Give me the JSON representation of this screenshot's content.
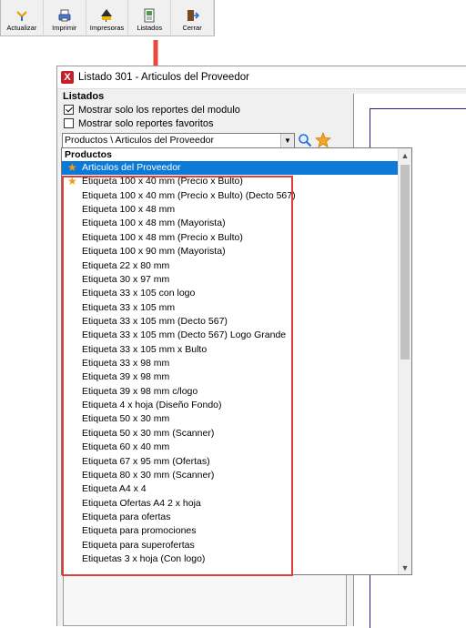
{
  "toolbar": {
    "buttons": [
      {
        "label": "Actualizar",
        "icon": "refresh-icon"
      },
      {
        "label": "Imprimir",
        "icon": "printer-icon"
      },
      {
        "label": "Impresoras",
        "icon": "printers-icon"
      },
      {
        "label": "Listados",
        "icon": "list-icon"
      },
      {
        "label": "Cerrar",
        "icon": "close-door-icon"
      }
    ]
  },
  "window": {
    "title": "Listado 301 - Articulos del Proveedor",
    "app_icon_letter": "X"
  },
  "listados": {
    "section_label": "Listados",
    "check_module": {
      "label": "Mostrar solo los reportes del modulo",
      "checked": true
    },
    "check_favorites": {
      "label": "Mostrar solo reportes favoritos",
      "checked": false
    },
    "combo_value": "Productos \\ Articulos del Proveedor"
  },
  "dropdown": {
    "group_header": "Productos",
    "items": [
      {
        "label": "Articulos del Proveedor",
        "favorite": true,
        "selected": true
      },
      {
        "label": "Etiqueta 100 x 40 mm (Precio x Bulto)",
        "favorite": true,
        "selected": false
      },
      {
        "label": "Etiqueta 100 x 40 mm (Precio x Bulto) (Decto 567)",
        "favorite": false,
        "selected": false
      },
      {
        "label": "Etiqueta 100 x 48 mm",
        "favorite": false,
        "selected": false
      },
      {
        "label": "Etiqueta 100 x 48 mm (Mayorista)",
        "favorite": false,
        "selected": false
      },
      {
        "label": "Etiqueta 100 x 48 mm (Precio x Bulto)",
        "favorite": false,
        "selected": false
      },
      {
        "label": "Etiqueta 100 x 90 mm (Mayorista)",
        "favorite": false,
        "selected": false
      },
      {
        "label": "Etiqueta 22 x 80 mm",
        "favorite": false,
        "selected": false
      },
      {
        "label": "Etiqueta 30 x 97 mm",
        "favorite": false,
        "selected": false
      },
      {
        "label": "Etiqueta 33 x 105 con logo",
        "favorite": false,
        "selected": false
      },
      {
        "label": "Etiqueta 33 x 105 mm",
        "favorite": false,
        "selected": false
      },
      {
        "label": "Etiqueta 33 x 105 mm (Decto 567)",
        "favorite": false,
        "selected": false
      },
      {
        "label": "Etiqueta 33 x 105 mm (Decto 567) Logo Grande",
        "favorite": false,
        "selected": false
      },
      {
        "label": "Etiqueta 33 x 105 mm x Bulto",
        "favorite": false,
        "selected": false
      },
      {
        "label": "Etiqueta 33 x 98 mm",
        "favorite": false,
        "selected": false
      },
      {
        "label": "Etiqueta 39 x 98 mm",
        "favorite": false,
        "selected": false
      },
      {
        "label": "Etiqueta 39 x 98 mm c/logo",
        "favorite": false,
        "selected": false
      },
      {
        "label": "Etiqueta 4 x hoja (Diseño Fondo)",
        "favorite": false,
        "selected": false
      },
      {
        "label": "Etiqueta 50 x 30 mm",
        "favorite": false,
        "selected": false
      },
      {
        "label": "Etiqueta 50 x 30 mm (Scanner)",
        "favorite": false,
        "selected": false
      },
      {
        "label": "Etiqueta 60 x 40 mm",
        "favorite": false,
        "selected": false
      },
      {
        "label": "Etiqueta 67 x 95 mm (Ofertas)",
        "favorite": false,
        "selected": false
      },
      {
        "label": "Etiqueta 80 x 30 mm (Scanner)",
        "favorite": false,
        "selected": false
      },
      {
        "label": "Etiqueta A4 x 4",
        "favorite": false,
        "selected": false
      },
      {
        "label": "Etiqueta Ofertas A4 2 x hoja",
        "favorite": false,
        "selected": false
      },
      {
        "label": "Etiqueta para ofertas",
        "favorite": false,
        "selected": false
      },
      {
        "label": "Etiqueta para promociones",
        "favorite": false,
        "selected": false
      },
      {
        "label": "Etiqueta para superofertas",
        "favorite": false,
        "selected": false
      },
      {
        "label": "Etiquetas 3 x hoja (Con logo)",
        "favorite": false,
        "selected": false
      }
    ]
  },
  "colors": {
    "selection": "#0a7ad6",
    "highlight_box": "#e03d3d",
    "favorite_star": "#f39c12"
  }
}
